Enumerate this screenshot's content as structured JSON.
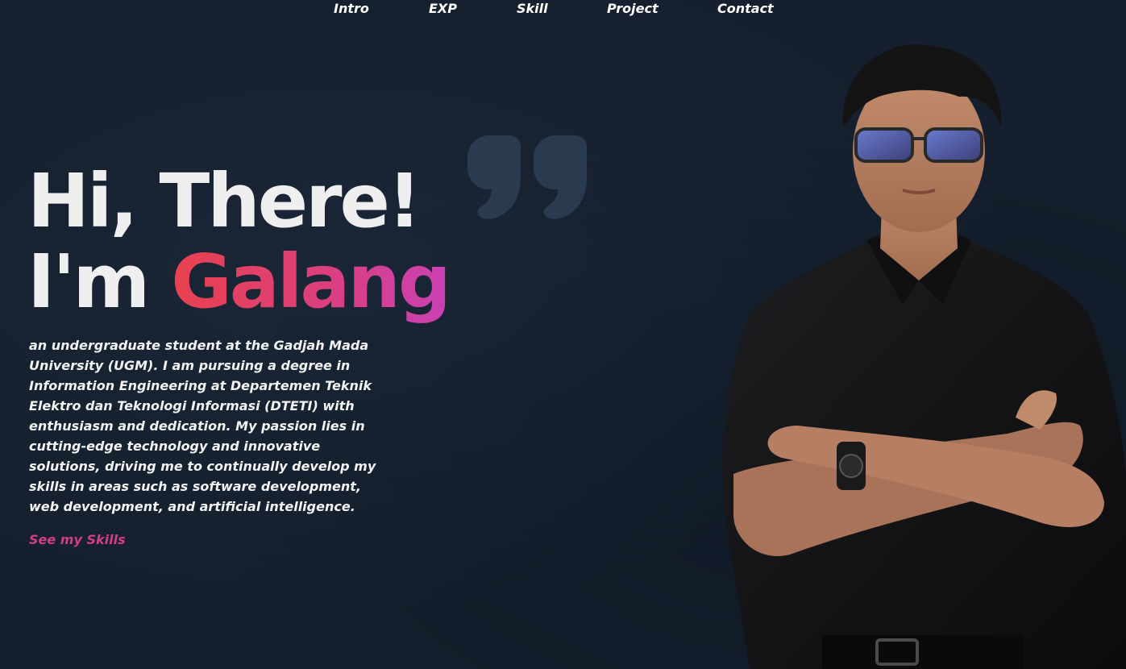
{
  "nav": {
    "items": [
      {
        "label": "Intro"
      },
      {
        "label": "EXP"
      },
      {
        "label": "Skill"
      },
      {
        "label": "Project"
      },
      {
        "label": "Contact"
      }
    ]
  },
  "hero": {
    "line1": "Hi, There!",
    "line2_prefix": "I'm",
    "name": "Galang",
    "bio": "an undergraduate student at the Gadjah Mada University (UGM). I am pursuing a degree in Information Engineering at Departemen Teknik Elektro dan Teknologi Informasi (DTETI) with enthusiasm and dedication. My passion lies in cutting-edge technology and innovative solutions, driving me to continually develop my skills in areas such as software development, web development, and artificial intelligence.",
    "cta_label": "See my Skills"
  },
  "colors": {
    "background": "#151f2d",
    "accent_start": "#e8414e",
    "accent_end": "#c840b4",
    "link": "#d33d86",
    "quote_mark": "#2b3b4f"
  },
  "icons": {
    "quote": "closing-quote-icon",
    "portrait": "portrait-photo"
  }
}
